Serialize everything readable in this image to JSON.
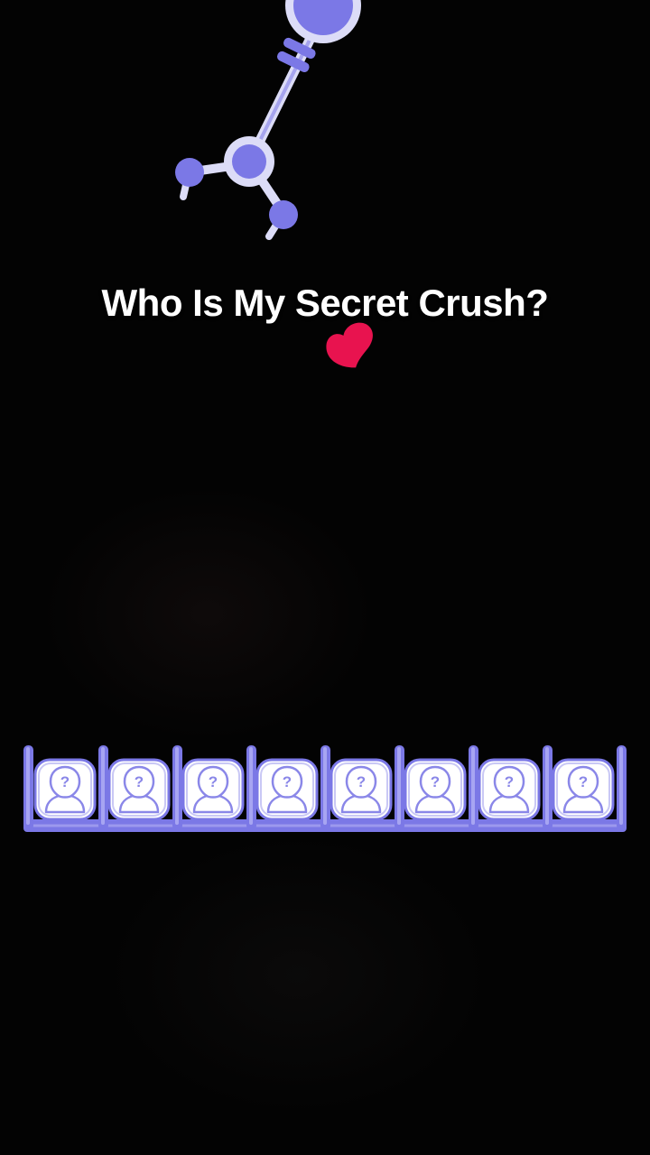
{
  "game": {
    "title": "Who Is My Secret Crush?"
  },
  "claw": {
    "icon": "claw-machine-grabber-icon",
    "color": "#7b78e6"
  },
  "heart": {
    "icon": "heart-icon",
    "color": "#e8134f"
  },
  "slots": {
    "count": 8,
    "icon": "mystery-person-icon",
    "label": "?",
    "frame_color": "#7b78e6",
    "card_color": "#ffffff"
  }
}
